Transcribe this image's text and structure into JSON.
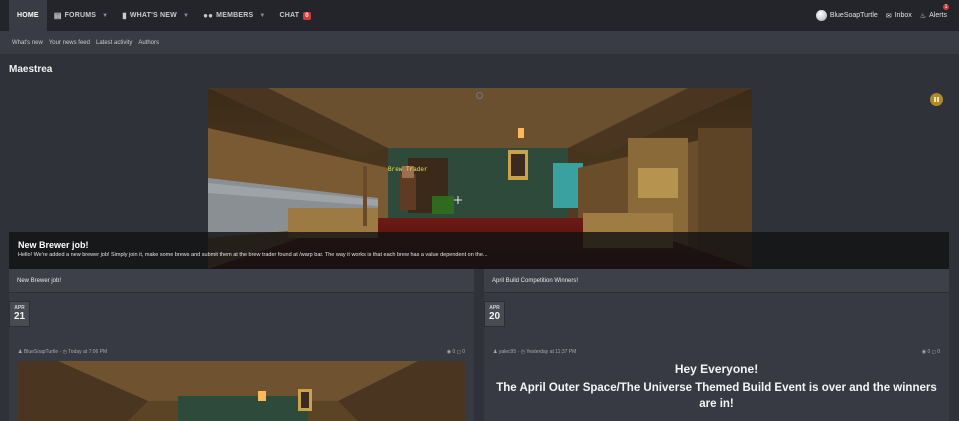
{
  "nav": {
    "items": [
      {
        "label": "HOME",
        "icon": "",
        "caret": false,
        "active": true
      },
      {
        "label": "FORUMS",
        "icon": "forums-icon",
        "caret": true
      },
      {
        "label": "WHAT'S NEW",
        "icon": "whats-new-icon",
        "caret": true
      },
      {
        "label": "MEMBERS",
        "icon": "members-icon",
        "caret": true
      },
      {
        "label": "CHAT",
        "badge": "0"
      }
    ],
    "user": "BlueSoapTurtle",
    "inbox": "Inbox",
    "alerts": "Alerts",
    "alerts_badge": "1"
  },
  "subnav": {
    "items": [
      "What's new",
      "Your news feed",
      "Latest activity",
      "Authors"
    ]
  },
  "page_title": "Maestrea",
  "hero": {
    "title": "New Brewer job!",
    "text": "Hello! We're added a new brewer job! Simply join it, make some brews and submit them at the brew trader found at /warp bar. The way it works is that each brew has a value dependent on the...",
    "npc_label": "Brew Trader",
    "accent": "#b08a2a"
  },
  "cards": [
    {
      "title": "New Brewer job!",
      "month": "APR",
      "day": "21",
      "author": "BlueSoapTurtle",
      "time": "Today at 7:06 PM",
      "views": "0",
      "comments": "0"
    },
    {
      "title": "April Build Competition Winners!",
      "month": "APR",
      "day": "20",
      "author": "yalec95",
      "time": "Yesterday at 11:37 PM",
      "views": "0",
      "comments": "0",
      "headline1": "Hey Everyone!",
      "headline2": "The April Outer Space/The Universe Themed Build Event is over and the winners are in!"
    }
  ]
}
